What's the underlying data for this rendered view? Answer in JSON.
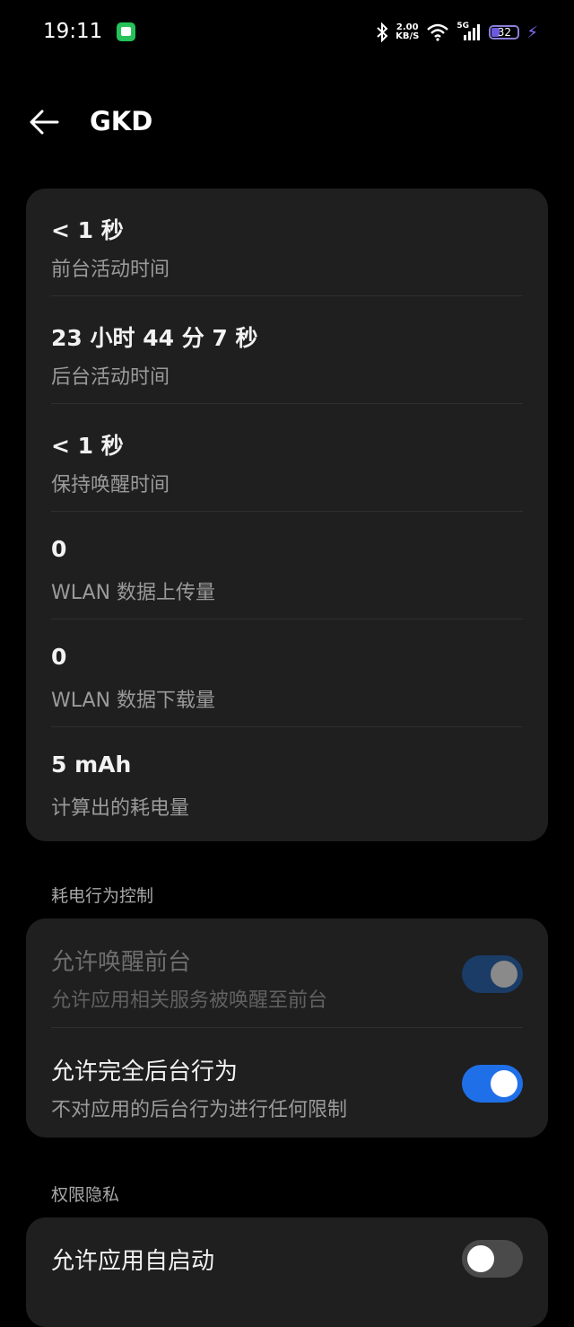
{
  "status_bar": {
    "time": "19:11",
    "net_speed_value": "2.00",
    "net_speed_unit": "KB/S",
    "network": "5G",
    "battery": "32",
    "battery_level": 0.32
  },
  "app_bar": {
    "title": "GKD"
  },
  "usage": {
    "items": [
      {
        "value": "< 1 秒",
        "label": "前台活动时间"
      },
      {
        "value": "23 小时 44 分 7 秒",
        "label": "后台活动时间"
      },
      {
        "value": "< 1 秒",
        "label": "保持唤醒时间"
      },
      {
        "value": "0",
        "label": "WLAN 数据上传量"
      },
      {
        "value": "0",
        "label": "WLAN 数据下载量"
      },
      {
        "value": "5 mAh",
        "label": "计算出的耗电量"
      }
    ]
  },
  "power_section": {
    "title": "耗电行为控制",
    "items": [
      {
        "title": "允许唤醒前台",
        "subtitle": "允许应用相关服务被唤醒至前台",
        "enabled": false,
        "checked": true
      },
      {
        "title": "允许完全后台行为",
        "subtitle": "不对应用的后台行为进行任何限制",
        "enabled": true,
        "checked": true
      }
    ]
  },
  "privacy_section": {
    "title": "权限隐私",
    "items": [
      {
        "title": "允许应用自启动",
        "checked": false
      }
    ]
  },
  "colors": {
    "background": "#000000",
    "card": "#1f1f1f",
    "accent": "#1f70e8"
  }
}
